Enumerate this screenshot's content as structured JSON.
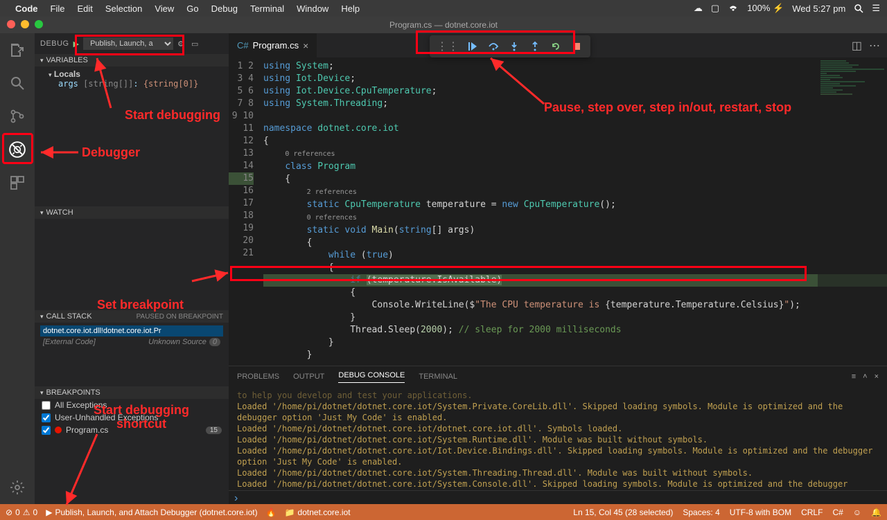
{
  "menubar": {
    "app": "Code",
    "items": [
      "File",
      "Edit",
      "Selection",
      "View",
      "Go",
      "Debug",
      "Terminal",
      "Window",
      "Help"
    ],
    "battery": "100%",
    "clock": "Wed 5:27 pm"
  },
  "title": "Program.cs — dotnet.core.iot",
  "activity": {
    "tip_debug": "Debug"
  },
  "sidebar": {
    "title": "DEBUG",
    "config": "Publish, Launch, a",
    "sections": {
      "variables": "VARIABLES",
      "locals": "Locals",
      "args_line": "args [string[]]: {string[0]}",
      "watch": "WATCH",
      "callstack": "CALL STACK",
      "callstack_status": "PAUSED ON BREAKPOINT",
      "cs_row1": "dotnet.core.iot.dll!dotnet.core.iot.Pr",
      "cs_row2": "[External Code]",
      "cs_row2b": "Unknown Source",
      "cs_badge": "0",
      "breakpoints": "BREAKPOINTS",
      "bp1": "All Exceptions",
      "bp2": "User-Unhandled Exceptions",
      "bp3": "Program.cs",
      "bp3_badge": "15"
    }
  },
  "tabs": {
    "file": "Program.cs"
  },
  "debug_toolbar": {
    "t1": "continue",
    "t2": "step-over",
    "t3": "step-into",
    "t4": "step-out",
    "t5": "restart",
    "t6": "stop"
  },
  "code": {
    "lines": [
      "1",
      "2",
      "3",
      "4",
      "5",
      "6",
      "7",
      "8",
      "",
      "9",
      "10",
      "",
      "11",
      "12",
      "13",
      "14",
      "15",
      "16",
      "17",
      "18",
      "19",
      "20",
      "21"
    ],
    "l1a": "using ",
    "l1b": "System",
    "l2a": "using ",
    "l2b": "Iot.Device",
    "l3a": "using ",
    "l3b": "Iot.Device.CpuTemperature",
    "l4a": "using ",
    "l4b": "System.Threading",
    "l6a": "namespace ",
    "l6b": "dotnet.core.iot",
    "l9a": "0 references",
    "l9b": "class ",
    "l9c": "Program",
    "l10a": "2 references",
    "l10b": "static ",
    "l10c": "CpuTemperature",
    "l10d": " temperature = ",
    "l10e": "new ",
    "l10f": "CpuTemperature",
    "l10g": "();",
    "l11a": "0 references",
    "l11b": "static void ",
    "l11c": "Main",
    "l11d": "(",
    "l11e": "string",
    "l11f": "[] args)",
    "l13a": "while ",
    "l13b": "(",
    "l13c": "true",
    "l13d": ")",
    "l15a": "if ",
    "l15b": "(temperature.IsAvailable)",
    "l17a": "Console.WriteLine($",
    "l17b": "\"The CPU temperature is ",
    "l17c": "{temperature.Temperature.Celsius}",
    "l17d": "\"",
    "l17e": ");",
    "l19a": "Thread.Sleep(",
    "l19b": "2000",
    "l19c": "); ",
    "l19d": "// sleep for 2000 milliseconds"
  },
  "panel": {
    "tabs": {
      "problems": "PROBLEMS",
      "output": "OUTPUT",
      "debug": "DEBUG CONSOLE",
      "terminal": "TERMINAL"
    },
    "lines": [
      "to help you develop and test your applications.",
      "Loaded '/home/pi/dotnet/dotnet.core.iot/System.Private.CoreLib.dll'. Skipped loading symbols. Module is optimized and the debugger option 'Just My Code' is enabled.",
      "Loaded '/home/pi/dotnet/dotnet.core.iot/dotnet.core.iot.dll'. Symbols loaded.",
      "Loaded '/home/pi/dotnet/dotnet.core.iot/System.Runtime.dll'. Module was built without symbols.",
      "Loaded '/home/pi/dotnet/dotnet.core.iot/Iot.Device.Bindings.dll'. Skipped loading symbols. Module is optimized and the debugger option 'Just My Code' is enabled.",
      "Loaded '/home/pi/dotnet/dotnet.core.iot/System.Threading.Thread.dll'. Module was built without symbols.",
      "Loaded '/home/pi/dotnet/dotnet.core.iot/System.Console.dll'. Skipped loading symbols. Module is optimized and the debugger option 'Just My Code' is enabled."
    ]
  },
  "statusbar": {
    "errors": "0",
    "warnings": "0",
    "launch": "Publish, Launch, and Attach Debugger (dotnet.core.iot)",
    "folder": "dotnet.core.iot",
    "pos": "Ln 15, Col 45 (28 selected)",
    "spaces": "Spaces: 4",
    "enc": "UTF-8 with BOM",
    "eol": "CRLF",
    "lang": "C#"
  },
  "annotations": {
    "start_debugging": "Start debugging",
    "debugger": "Debugger",
    "toolbar": "Pause, step over, step in/out, restart, stop",
    "set_bp": "Set breakpoint",
    "start_shortcut": "Start debugging\nshortcut"
  }
}
